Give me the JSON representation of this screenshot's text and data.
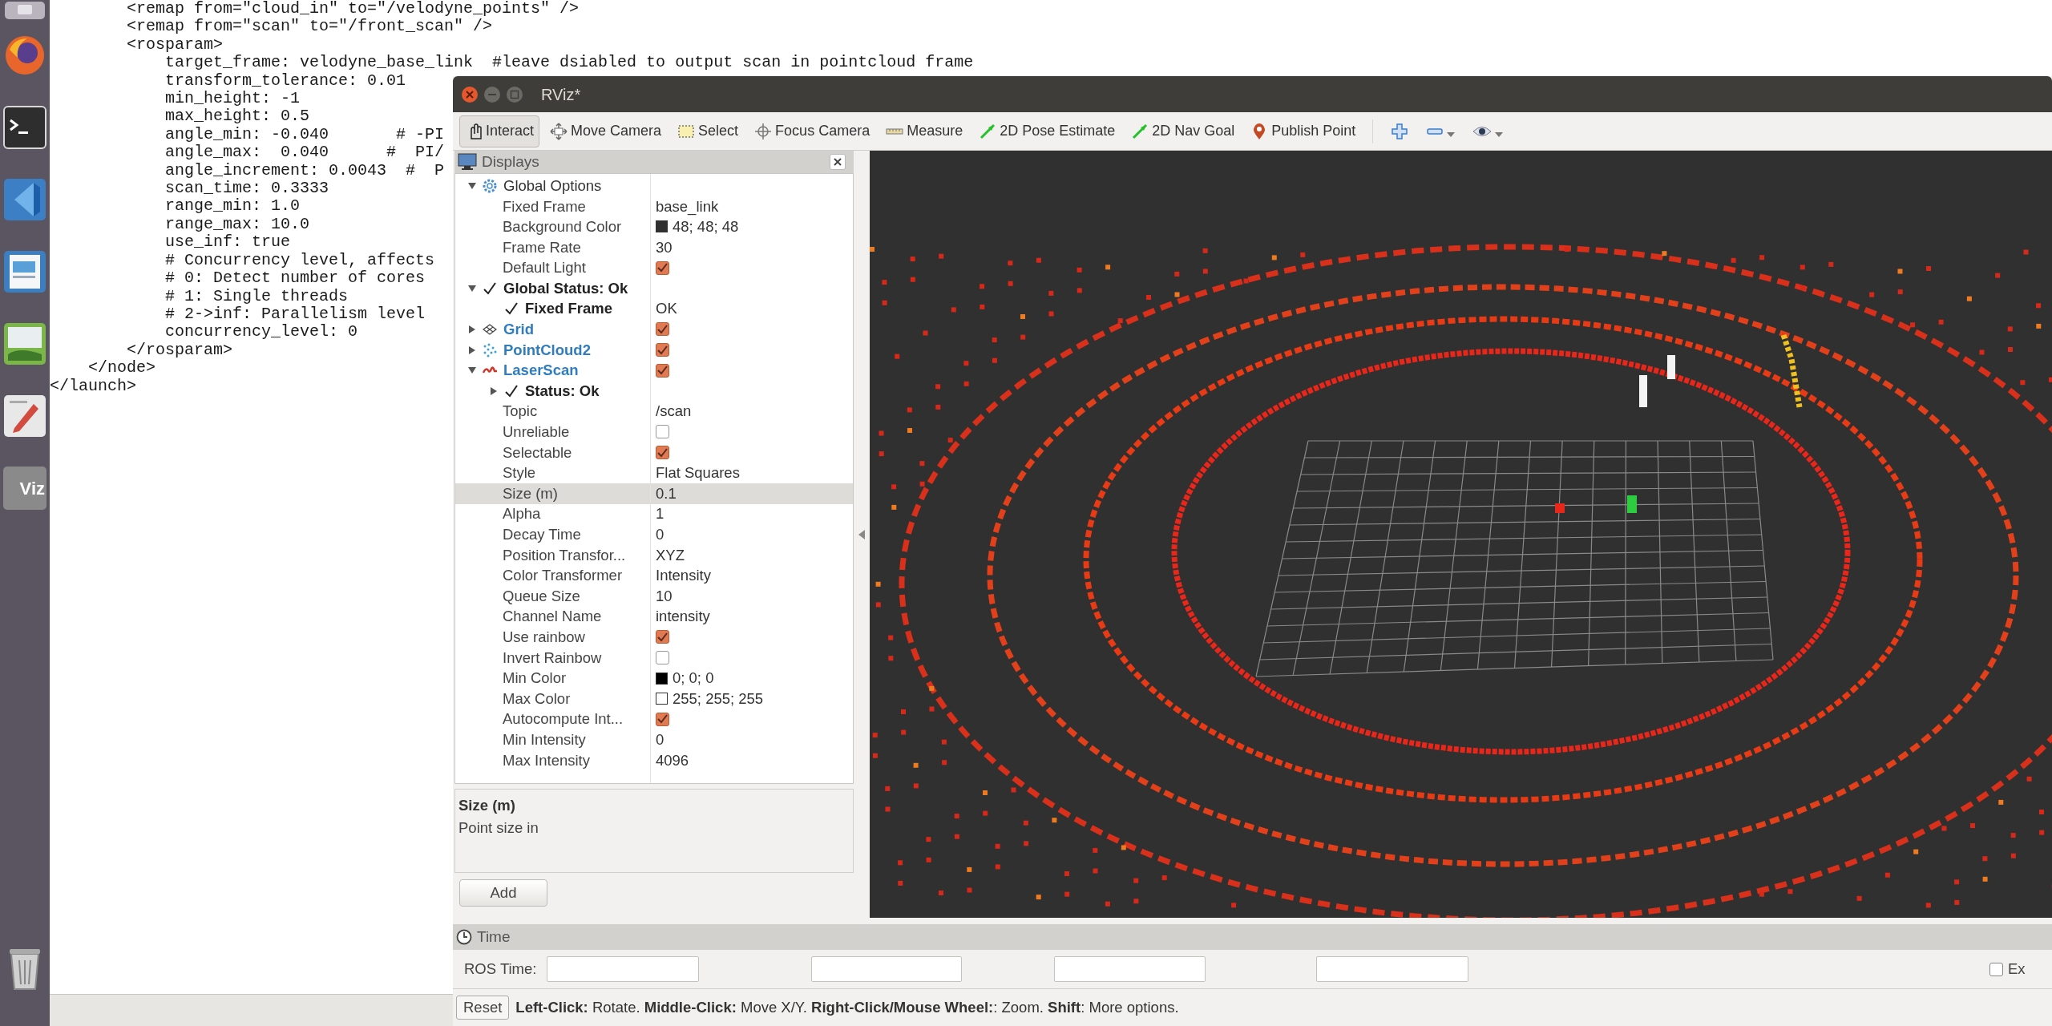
{
  "launcher": {
    "label": "Viz"
  },
  "editor": {
    "lines": [
      "        <remap from=\"cloud_in\" to=\"/velodyne_points\" />",
      "        <remap from=\"scan\" to=\"/front_scan\" />",
      "        <rosparam>",
      "            target_frame: velodyne_base_link  #leave dsiabled to output scan in pointcloud frame",
      "            transform_tolerance: 0.01",
      "            min_height: -1",
      "            max_height: 0.5",
      "            angle_min: -0.040       # -PI",
      "            angle_max:  0.040      #  PI/",
      "            angle_increment: 0.0043  #  P",
      "            scan_time: 0.3333",
      "            range_min: 1.0",
      "            range_max: 10.0",
      "            use_inf: true",
      "            # Concurrency level, affects",
      "            # 0: Detect number of cores",
      "            # 1: Single threads",
      "            # 2->inf: Parallelism level",
      "            concurrency_level: 0",
      "        </rosparam>",
      "    </node>",
      "</launch>"
    ]
  },
  "window": {
    "title": "RViz*"
  },
  "toolbar": [
    {
      "label": "Interact",
      "selected": true
    },
    {
      "label": "Move Camera",
      "selected": false
    },
    {
      "label": "Select",
      "selected": false
    },
    {
      "label": "Focus Camera",
      "selected": false
    },
    {
      "label": "Measure",
      "selected": false
    },
    {
      "label": "2D Pose Estimate",
      "selected": false
    },
    {
      "label": "2D Nav Goal",
      "selected": false
    },
    {
      "label": "Publish Point",
      "selected": false
    }
  ],
  "displays": {
    "title": "Displays",
    "rows": [
      {
        "label": "Global Options",
        "kind": "group",
        "expanded": true,
        "selected": false,
        "children": [
          {
            "label": "Fixed Frame",
            "kind": "property",
            "value": "base_link",
            "selected": false
          },
          {
            "label": "Background Color",
            "kind": "property",
            "color": "#303030",
            "value": "48; 48; 48",
            "selected": false
          },
          {
            "label": "Frame Rate",
            "kind": "property",
            "value": "30",
            "selected": false
          },
          {
            "label": "Default Light",
            "kind": "property",
            "checked": true,
            "selected": false
          }
        ]
      },
      {
        "label": "Global Status: Ok",
        "kind": "status",
        "expanded": true,
        "selected": false,
        "children": [
          {
            "label": "Fixed Frame",
            "kind": "status",
            "value": "OK",
            "selected": false
          }
        ]
      },
      {
        "label": "Grid",
        "kind": "display",
        "expanded": false,
        "checked": true,
        "selected": false
      },
      {
        "label": "PointCloud2",
        "kind": "display",
        "expanded": false,
        "checked": true,
        "selected": false
      },
      {
        "label": "LaserScan",
        "kind": "display",
        "expanded": true,
        "checked": true,
        "selected": false,
        "children": [
          {
            "label": "Status: Ok",
            "kind": "status",
            "expanded": false,
            "selected": false
          },
          {
            "label": "Topic",
            "kind": "property",
            "value": "/scan",
            "selected": false
          },
          {
            "label": "Unreliable",
            "kind": "property",
            "checked": false,
            "selected": false
          },
          {
            "label": "Selectable",
            "kind": "property",
            "checked": true,
            "selected": false
          },
          {
            "label": "Style",
            "kind": "property",
            "value": "Flat Squares",
            "selected": false
          },
          {
            "label": "Size (m)",
            "kind": "property",
            "value": "0.1",
            "selected": true
          },
          {
            "label": "Alpha",
            "kind": "property",
            "value": "1",
            "selected": false
          },
          {
            "label": "Decay Time",
            "kind": "property",
            "value": "0",
            "selected": false
          },
          {
            "label": "Position Transfor...",
            "kind": "property",
            "value": "XYZ",
            "selected": false
          },
          {
            "label": "Color Transformer",
            "kind": "property",
            "value": "Intensity",
            "selected": false
          },
          {
            "label": "Queue Size",
            "kind": "property",
            "value": "10",
            "selected": false
          },
          {
            "label": "Channel Name",
            "kind": "property",
            "value": "intensity",
            "selected": false
          },
          {
            "label": "Use rainbow",
            "kind": "property",
            "checked": true,
            "selected": false
          },
          {
            "label": "Invert Rainbow",
            "kind": "property",
            "checked": false,
            "selected": false
          },
          {
            "label": "Min Color",
            "kind": "property",
            "color": "#000000",
            "value": "0; 0; 0",
            "selected": false
          },
          {
            "label": "Max Color",
            "kind": "property",
            "color": "#ffffff",
            "value": "255; 255; 255",
            "selected": false
          },
          {
            "label": "Autocompute Int...",
            "kind": "property",
            "checked": true,
            "selected": false
          },
          {
            "label": "Min Intensity",
            "kind": "property",
            "value": "0",
            "selected": false
          },
          {
            "label": "Max Intensity",
            "kind": "property",
            "value": "4096",
            "selected": false
          }
        ]
      }
    ]
  },
  "description": {
    "title": "Size (m)",
    "text": "Point size in"
  },
  "add_button": "Add",
  "time_panel": {
    "title": "Time",
    "ros_time_label": "ROS Time:",
    "experimental_label": "Ex",
    "experimental_checked": false
  },
  "status_bar": {
    "reset": "Reset",
    "hint": "**Left-Click:** Rotate. **Middle-Click:** Move X/Y. **Right-Click/Mouse Wheel:**: Zoom. **Shift**: More options."
  }
}
